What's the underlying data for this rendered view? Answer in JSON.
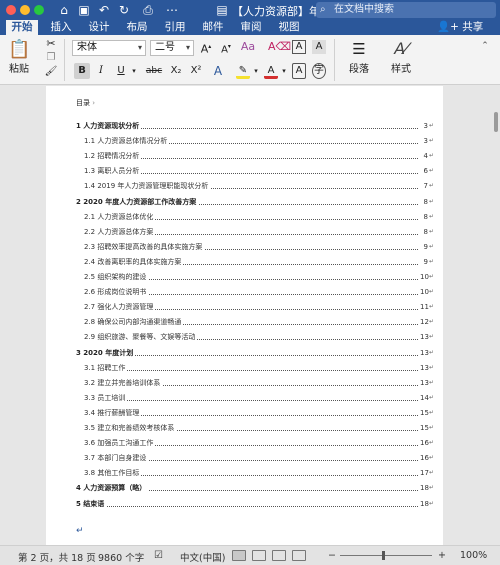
{
  "window": {
    "title": "【人力资源部】年…",
    "search_placeholder": "在文档中搜索",
    "share_label": "共享",
    "colors": {
      "titlebar": "#2b579a",
      "close": "#fe5f57",
      "minimize": "#febc2e",
      "zoom": "#28c840"
    }
  },
  "tabs": [
    {
      "label": "开始",
      "active": true
    },
    {
      "label": "插入",
      "active": false
    },
    {
      "label": "设计",
      "active": false
    },
    {
      "label": "布局",
      "active": false
    },
    {
      "label": "引用",
      "active": false
    },
    {
      "label": "邮件",
      "active": false
    },
    {
      "label": "审阅",
      "active": false
    },
    {
      "label": "视图",
      "active": false
    }
  ],
  "ribbon": {
    "paste_label": "粘贴",
    "font_name": "宋体",
    "font_size": "二号",
    "paragraph_label": "段落",
    "styles_label": "样式",
    "format_buttons": [
      "B",
      "I",
      "U",
      "abc",
      "X₂",
      "X²",
      "A",
      "A",
      "A",
      "字"
    ],
    "font_color": "#d32f2f",
    "highlight_color": "#f5e12f"
  },
  "document": {
    "toc_heading": "目录",
    "toc": [
      {
        "text": "1 人力资源现状分析",
        "page": "3",
        "level": 1
      },
      {
        "text": "1.1 人力资源总体情况分析",
        "page": "3",
        "level": 2
      },
      {
        "text": "1.2 招聘情况分析",
        "page": "4",
        "level": 2
      },
      {
        "text": "1.3 离职人员分析",
        "page": "6",
        "level": 2
      },
      {
        "text": "1.4 2019 年人力资源管理职能现状分析",
        "page": "7",
        "level": 2
      },
      {
        "text": "2 2020 年度人力资源部工作改善方案",
        "page": "8",
        "level": 1
      },
      {
        "text": "2.1 人力资源总体优化",
        "page": "8",
        "level": 2
      },
      {
        "text": "2.2 人力资源总体方案",
        "page": "8",
        "level": 2
      },
      {
        "text": "2.3 招聘效率提高改善的具体实施方案",
        "page": "9",
        "level": 2
      },
      {
        "text": "2.4 改善离职率的具体实施方案",
        "page": "9",
        "level": 2
      },
      {
        "text": "2.5 组织架构的建设",
        "page": "10",
        "level": 2
      },
      {
        "text": "2.6 形成岗位说明书",
        "page": "10",
        "level": 2
      },
      {
        "text": "2.7 强化人力资源管理",
        "page": "11",
        "level": 2
      },
      {
        "text": "2.8 确保公司内部沟通渠道畅通",
        "page": "12",
        "level": 2
      },
      {
        "text": "2.9 组织旅游、聚餐等、文娱等活动",
        "page": "13",
        "level": 2
      },
      {
        "text": "3 2020 年度计划",
        "page": "13",
        "level": 1
      },
      {
        "text": "3.1 招聘工作",
        "page": "13",
        "level": 2
      },
      {
        "text": "3.2 建立并完善培训体系",
        "page": "13",
        "level": 2
      },
      {
        "text": "3.3 员工培训",
        "page": "14",
        "level": 2
      },
      {
        "text": "3.4 推行薪酬管理",
        "page": "15",
        "level": 2
      },
      {
        "text": "3.5 建立和完善绩效考核体系",
        "page": "15",
        "level": 2
      },
      {
        "text": "3.6 加强员工沟通工作",
        "page": "16",
        "level": 2
      },
      {
        "text": "3.7 本部门自身建设",
        "page": "16",
        "level": 2
      },
      {
        "text": "3.8 其他工作目标",
        "page": "17",
        "level": 2
      },
      {
        "text": "4 人力资源预算（略）",
        "page": "18",
        "level": 1
      },
      {
        "text": "5  结束语",
        "page": "18",
        "level": 1
      }
    ]
  },
  "status": {
    "page_info": "第 2 页，共 18 页",
    "word_count": "9860 个字",
    "language": "中文(中国)",
    "zoom": "100%"
  }
}
